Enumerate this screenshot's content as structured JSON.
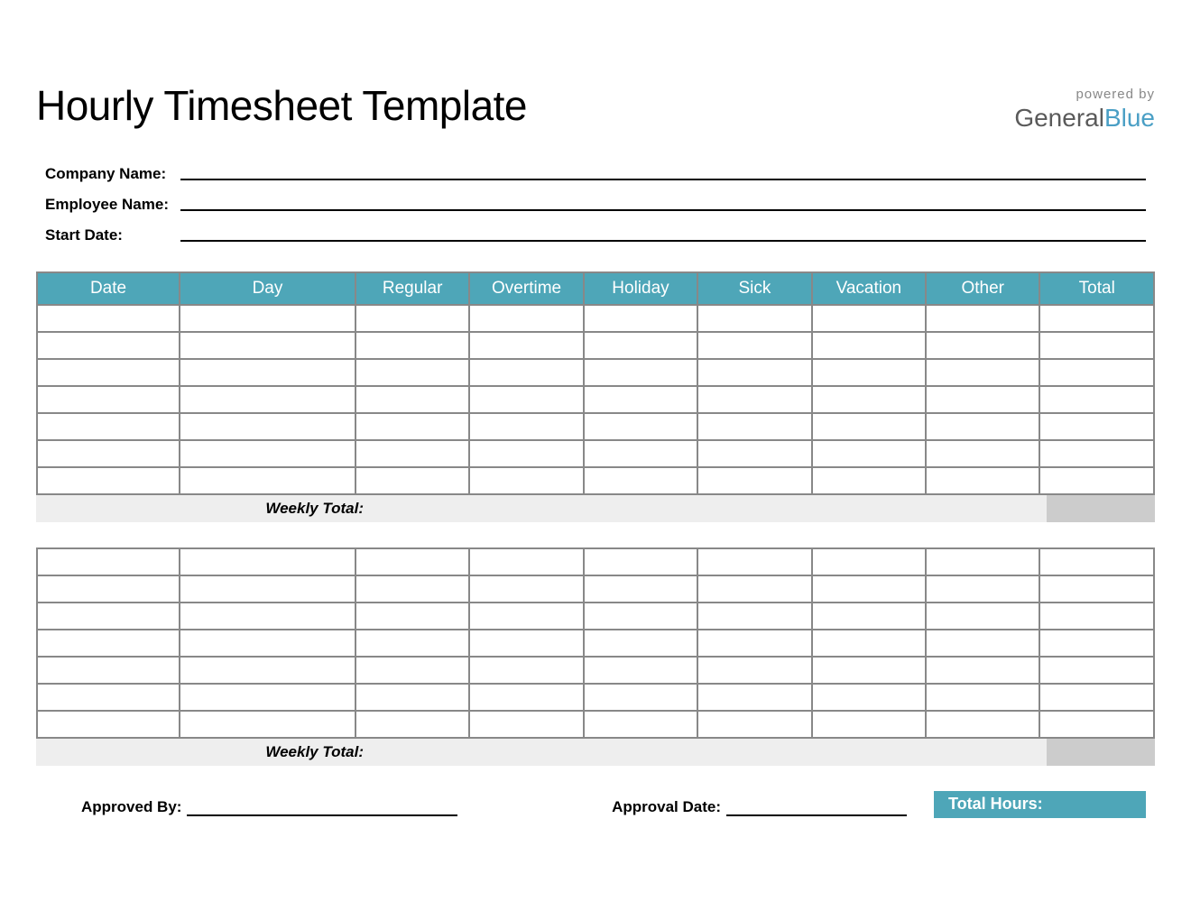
{
  "title": "Hourly Timesheet Template",
  "brand": {
    "powered_by": "powered by",
    "name1": "General",
    "name2": "Blue"
  },
  "fields": {
    "company_label": "Company Name:",
    "employee_label": "Employee Name:",
    "start_date_label": "Start Date:"
  },
  "columns": {
    "date": "Date",
    "day": "Day",
    "regular": "Regular",
    "overtime": "Overtime",
    "holiday": "Holiday",
    "sick": "Sick",
    "vacation": "Vacation",
    "other": "Other",
    "total": "Total"
  },
  "weekly_total_label": "Weekly Total:",
  "footer": {
    "approved_by": "Approved By:",
    "approval_date": "Approval Date:",
    "total_hours": "Total Hours:"
  }
}
